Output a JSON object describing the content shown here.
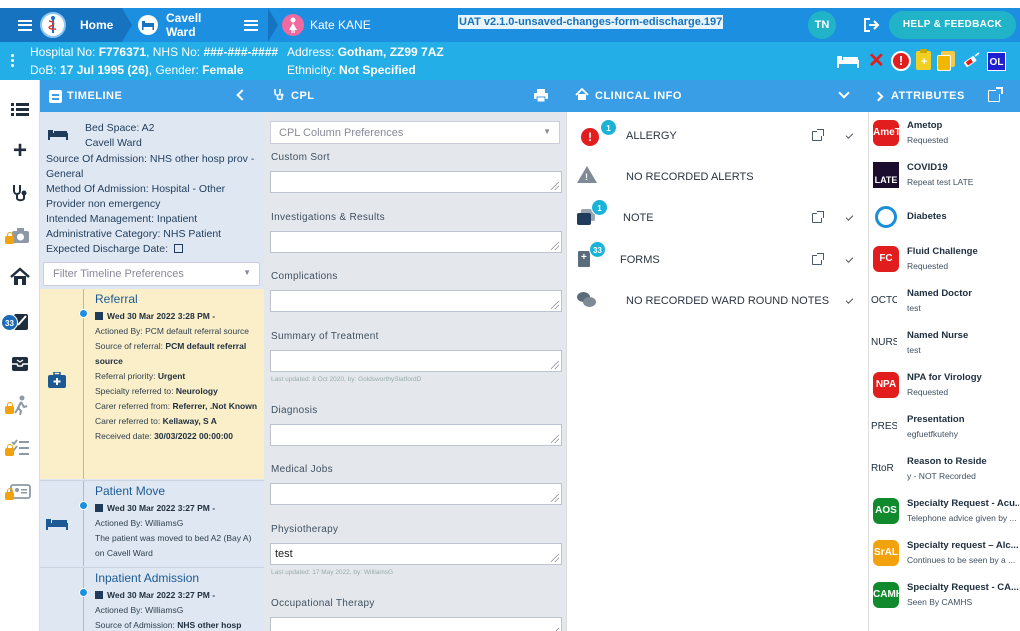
{
  "topbar": {
    "home_label": "Home",
    "ward_label": "Cavell Ward",
    "patient_name": "Kate KANE",
    "env_title": "UAT v2.1.0-unsaved-changes-form-edischarge.197",
    "user_initials": "TN",
    "help_label": "HELP & FEEDBACK"
  },
  "patient_banner": {
    "hospital_no_label": "Hospital No:",
    "hospital_no": "F776371",
    "nhs_no_label": "NHS No:",
    "nhs_no": "###-###-####",
    "address_label": "Address:",
    "address": "Gotham, ZZ99 7AZ",
    "dob_label": "DoB:",
    "dob": "17 Jul 1995 (26)",
    "gender_label": "Gender:",
    "gender": "Female",
    "ethnicity_label": "Ethnicity:",
    "ethnicity": "Not Specified",
    "alert_icon_ol": "OL"
  },
  "panels": {
    "timeline": "TIMELINE",
    "cpl": "CPL",
    "clinical_info": "CLINICAL INFO",
    "attributes": "ATTRIBUTES"
  },
  "timeline": {
    "bed_space": "Bed Space: A2",
    "ward": "Cavell Ward",
    "source_of_admission": "Source Of Admission: NHS other hosp prov - General",
    "method_of_admission": "Method Of Admission: Hospital - Other Provider non emergency",
    "intended_management": "Intended Management: Inpatient",
    "admin_category": "Administrative Category: NHS Patient",
    "expected_discharge": "Expected Discharge Date:",
    "filter_placeholder": "Filter Timeline Preferences",
    "events": [
      {
        "title": "Referral",
        "date": "Wed 30 Mar 2022 3:28 PM -",
        "actioned_by": "Actioned By: PCM default referral source",
        "source_label": "Source of referral:",
        "source_value": "PCM default referral source",
        "priority_label": "Referral priority:",
        "priority_value": "Urgent",
        "specialty_label": "Specialty referred to:",
        "specialty_value": "Neurology",
        "carer_from_label": "Carer referred from:",
        "carer_from_value": "Referrer, .Not Known",
        "carer_to_label": "Carer referred to:",
        "carer_to_value": "Kellaway, S A",
        "received_label": "Received date:",
        "received_value": "30/03/2022 00:00:00"
      },
      {
        "title": "Patient Move",
        "date": "Wed 30 Mar 2022 3:27 PM -",
        "actioned_by": "Actioned By: WilliamsG",
        "text": "The patient was moved to bed A2 (Bay A) on Cavell Ward"
      },
      {
        "title": "Inpatient Admission",
        "date": "Wed 30 Mar 2022 3:27 PM -",
        "actioned_by": "Actioned By: WilliamsG",
        "source_label": "Source of Admission:",
        "source_value": "NHS other hosp"
      }
    ]
  },
  "cpl": {
    "column_prefs_placeholder": "CPL Column Preferences",
    "sections": [
      {
        "title": "Custom Sort",
        "value": "",
        "note": ""
      },
      {
        "title": "Investigations & Results",
        "value": "",
        "note": ""
      },
      {
        "title": "Complications",
        "value": "",
        "note": ""
      },
      {
        "title": "Summary of Treatment",
        "value": "",
        "note": "Last updated: 8 Oct 2020, by: GoldsworthySlatfordD"
      },
      {
        "title": "Diagnosis",
        "value": "",
        "note": ""
      },
      {
        "title": "Medical Jobs",
        "value": "",
        "note": ""
      },
      {
        "title": "Physiotherapy",
        "value": "test",
        "note": "Last updated: 17 May 2022, by: WilliamsG"
      },
      {
        "title": "Occupational Therapy",
        "value": "",
        "note": ""
      }
    ]
  },
  "clinical_info": {
    "rows": [
      {
        "label": "ALLERGY",
        "badge": "1"
      },
      {
        "label": "NO RECORDED ALERTS",
        "badge": ""
      },
      {
        "label": "NOTE",
        "badge": "1"
      },
      {
        "label": "FORMS",
        "badge": "33"
      },
      {
        "label": "NO RECORDED WARD ROUND NOTES",
        "badge": ""
      }
    ]
  },
  "attributes": {
    "items": [
      {
        "icon_text": "AmeT",
        "icon_color": "#e11d1d",
        "name": "Ametop",
        "status": "Requested"
      },
      {
        "icon_text": "LATE",
        "icon_color": "#6a3aa8",
        "name": "COVID19",
        "status": "Repeat test LATE"
      },
      {
        "icon_text": "",
        "icon_color": "#1a8fd8",
        "name": "Diabetes",
        "status": ""
      },
      {
        "icon_text": "FC",
        "icon_color": "#e11d1d",
        "name": "Fluid Challenge",
        "status": "Requested"
      },
      {
        "icon_text": "OCTO",
        "icon_color": "#ffffff",
        "name": "Named Doctor",
        "status": "test"
      },
      {
        "icon_text": "NURSI",
        "icon_color": "#ffffff",
        "name": "Named Nurse",
        "status": "test"
      },
      {
        "icon_text": "NPA",
        "icon_color": "#e11d1d",
        "name": "NPA for Virology",
        "status": "Requested"
      },
      {
        "icon_text": "PRESE",
        "icon_color": "#ffffff",
        "name": "Presentation",
        "status": "egfuetfkutehy"
      },
      {
        "icon_text": "RtoR",
        "icon_color": "#ffffff",
        "name": "Reason to Reside",
        "status": "y - NOT Recorded"
      },
      {
        "icon_text": "AOS",
        "icon_color": "#118a2e",
        "name": "Specialty Request - Acu...",
        "status": "Telephone advice given by ..."
      },
      {
        "icon_text": "SrAL",
        "icon_color": "#f2a20c",
        "name": "Specialty request – Alc...",
        "status": "Continues to be seen by a ..."
      },
      {
        "icon_text": "CAMH",
        "icon_color": "#118a2e",
        "name": "Specialty Request - CA...",
        "status": "Seen By CAMHS"
      }
    ]
  },
  "left_nav": {
    "forms_badge": "33"
  }
}
